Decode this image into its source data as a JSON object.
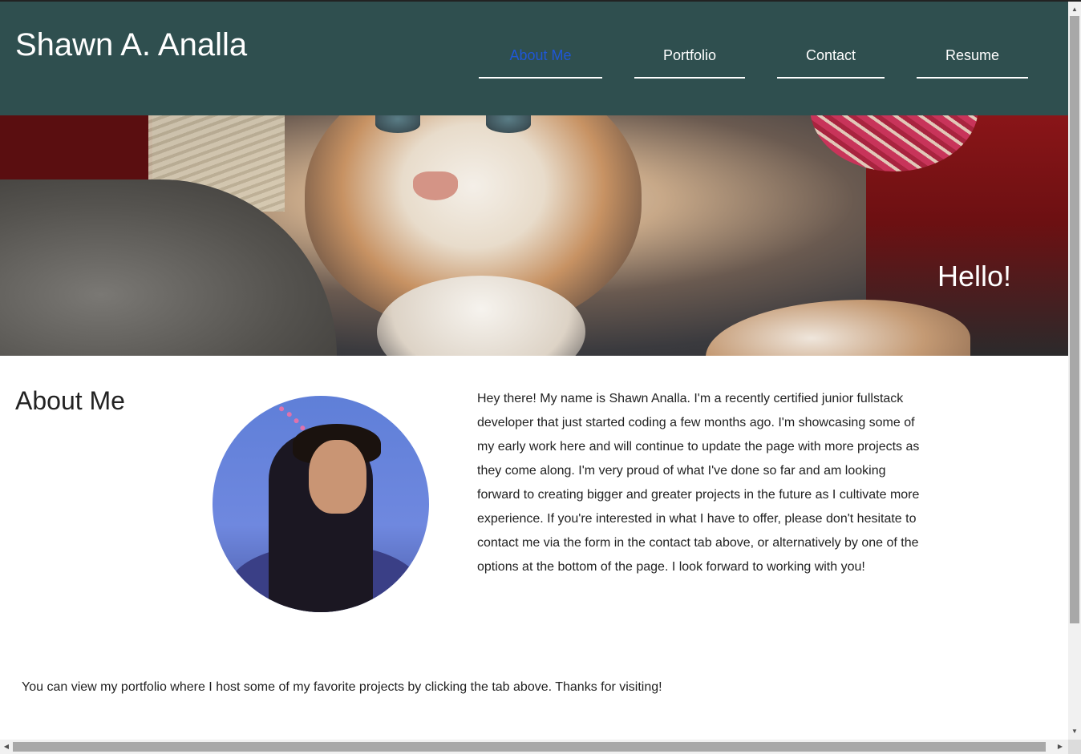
{
  "header": {
    "site_title": "Shawn A. Analla",
    "nav": [
      {
        "label": "About Me",
        "active": true
      },
      {
        "label": "Portfolio",
        "active": false
      },
      {
        "label": "Contact",
        "active": false
      },
      {
        "label": "Resume",
        "active": false
      }
    ],
    "background_color": "#2f4f4f",
    "active_color": "#1f57d6"
  },
  "hero": {
    "greeting": "Hello!",
    "image": "calico-kitten-photo"
  },
  "about": {
    "heading": "About Me",
    "avatar": "profile-photo",
    "bio": "Hey there! My name is Shawn Analla. I'm a recently certified junior fullstack developer that just started coding a few months ago. I'm showcasing some of my early work here and will continue to update the page with more projects as they come along. I'm very proud of what I've done so far and am looking forward to creating bigger and greater projects in the future as I cultivate more experience. If you're interested in what I have to offer, please don't hesitate to contact me via the form in the contact tab above, or alternatively by one of the options at the bottom of the page. I look forward to working with you!"
  },
  "footer": {
    "text": "You can view my portfolio where I host some of my favorite projects by clicking the tab above. Thanks for visiting!"
  }
}
